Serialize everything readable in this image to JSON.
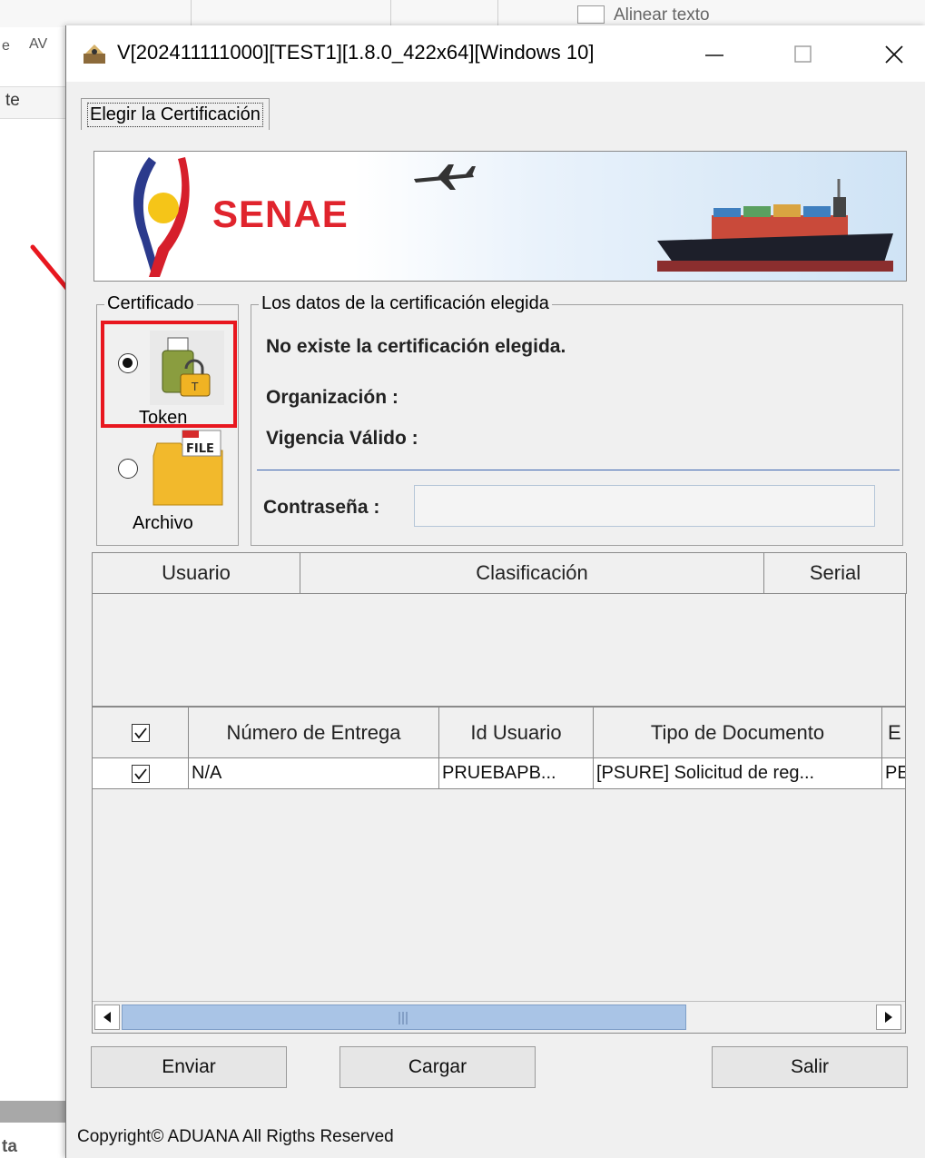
{
  "background_app": {
    "ribbon_label": "Alinear texto",
    "left_fragment": "te",
    "frag_e": "e",
    "frag_av": "AV",
    "frag_bottom": "ta"
  },
  "dialog": {
    "title": "V[202411111000][TEST1][1.8.0_422x64][Windows 10]",
    "controls": {
      "minimize": "—",
      "maximize": "☐",
      "close": "✕"
    },
    "tab_label": "Elegir la Certificación",
    "banner": {
      "logo_text": "SENAE"
    },
    "certificado": {
      "legend": "Certificado",
      "options": [
        {
          "label": "Token",
          "selected": true
        },
        {
          "label": "Archivo",
          "selected": false
        }
      ]
    },
    "datos": {
      "legend": "Los datos de la certificación elegida",
      "status": "No existe la certificación elegida.",
      "organizacion_label": "Organización :",
      "vigencia_label": "Vigencia Válido :",
      "password_label": "Contraseña :",
      "password_value": ""
    },
    "cert_table": {
      "columns": [
        "Usuario",
        "Clasificación",
        "Serial"
      ]
    },
    "delivery_table": {
      "columns": [
        "Número de Entrega",
        "Id Usuario",
        "Tipo de Documento",
        "E"
      ],
      "rows": [
        {
          "checked": true,
          "numero": "N/A",
          "usuario": "PRUEBAPB...",
          "tipo": "[PSURE] Solicitud de reg...",
          "extra": "PE"
        }
      ]
    },
    "buttons": {
      "enviar": "Enviar",
      "cargar": "Cargar",
      "salir": "Salir"
    },
    "copyright": "Copyright© ADUANA All Rigths Reserved"
  },
  "colors": {
    "highlight": "#e8171f",
    "senae_red": "#e0242d",
    "scroll_thumb": "#a9c4e6"
  }
}
